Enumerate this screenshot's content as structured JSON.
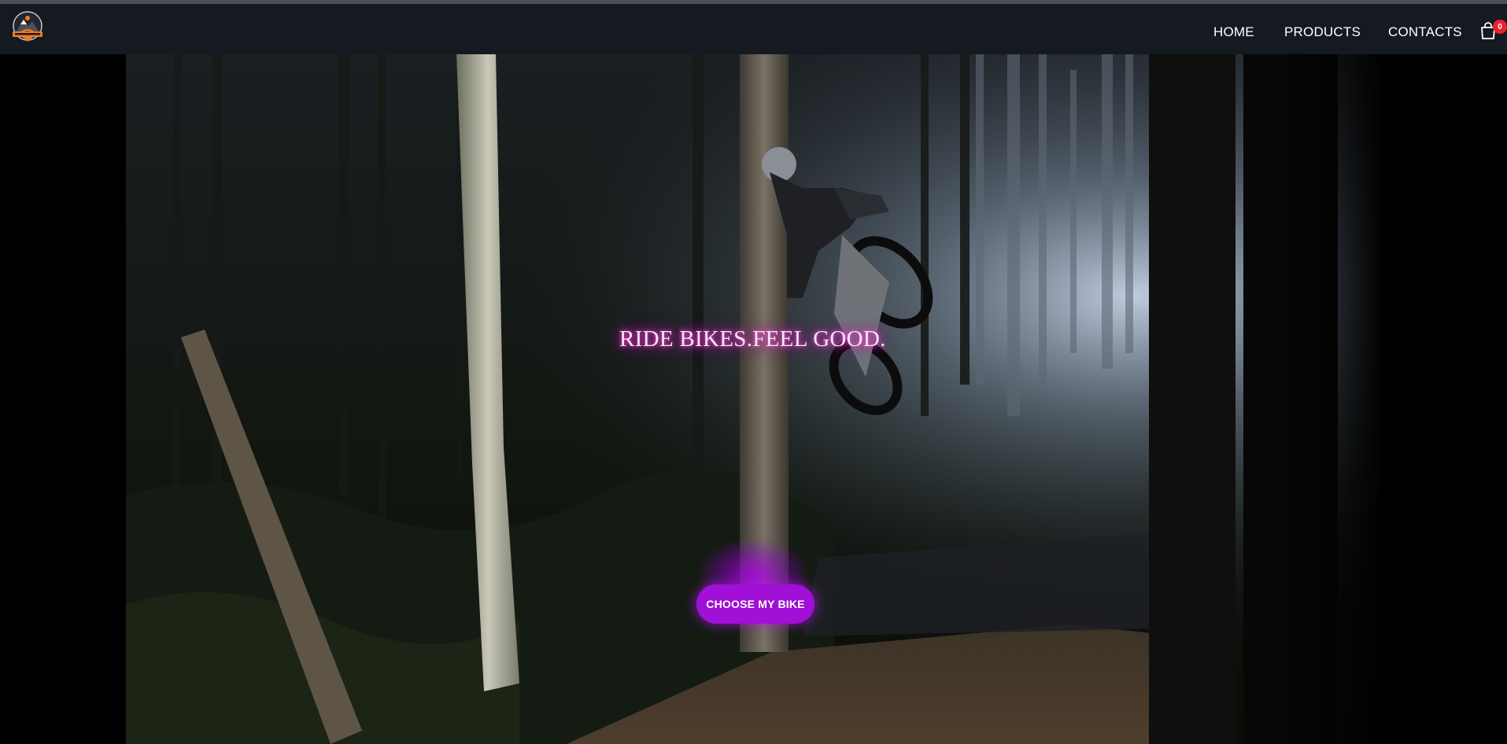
{
  "nav": {
    "logo_alt": "Mountain Bike",
    "home": "HOME",
    "products": "PRODUCTS",
    "contacts": "CONTACTS",
    "cart_count": "0",
    "cart_icon": "shopping-bag-icon"
  },
  "hero": {
    "headline": "RIDE BIKES.FEEL GOOD.",
    "cta_label": "CHOOSE MY BIKE",
    "image_description_icon": "mountain-bike-forest-photo"
  },
  "colors": {
    "navbar_bg": "#151a21",
    "accent_purple": "#a010d6",
    "glow_pink": "#ff4dd8",
    "badge_red": "#e8232e"
  }
}
